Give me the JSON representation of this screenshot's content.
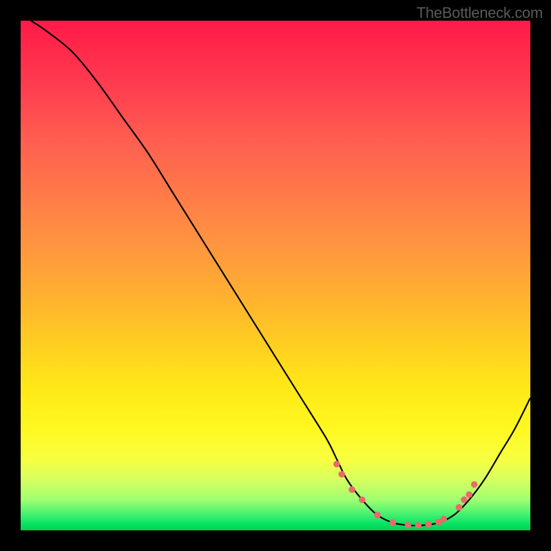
{
  "watermark": "TheBottleneck.com",
  "chart_data": {
    "type": "line",
    "title": "",
    "xlabel": "",
    "ylabel": "",
    "xlim": [
      0,
      100
    ],
    "ylim": [
      0,
      100
    ],
    "gradient_meaning": "background color encodes bottleneck severity: red=high, yellow=medium, green=low",
    "series": [
      {
        "name": "bottleneck-curve",
        "x": [
          2,
          5,
          10,
          15,
          20,
          25,
          30,
          35,
          40,
          45,
          50,
          55,
          60,
          62,
          64,
          67,
          70,
          73,
          76,
          79,
          82,
          85,
          88,
          91,
          94,
          97,
          100
        ],
        "y": [
          100,
          98,
          94,
          88,
          81,
          74,
          66,
          58,
          50,
          42,
          34,
          26,
          18,
          14,
          10,
          6,
          3,
          1.5,
          1,
          1,
          1.5,
          3,
          6,
          10,
          15,
          20,
          26
        ]
      }
    ],
    "highlight_dots": {
      "description": "pink dots near curve minimum (optimal zone)",
      "x": [
        62,
        63,
        65,
        67,
        70,
        73,
        76,
        78,
        80,
        82,
        83,
        86,
        87,
        88,
        89
      ],
      "y": [
        13,
        11,
        8,
        6,
        3,
        1.5,
        1,
        1,
        1.2,
        1.6,
        2.2,
        4.5,
        6,
        7,
        9
      ]
    }
  }
}
